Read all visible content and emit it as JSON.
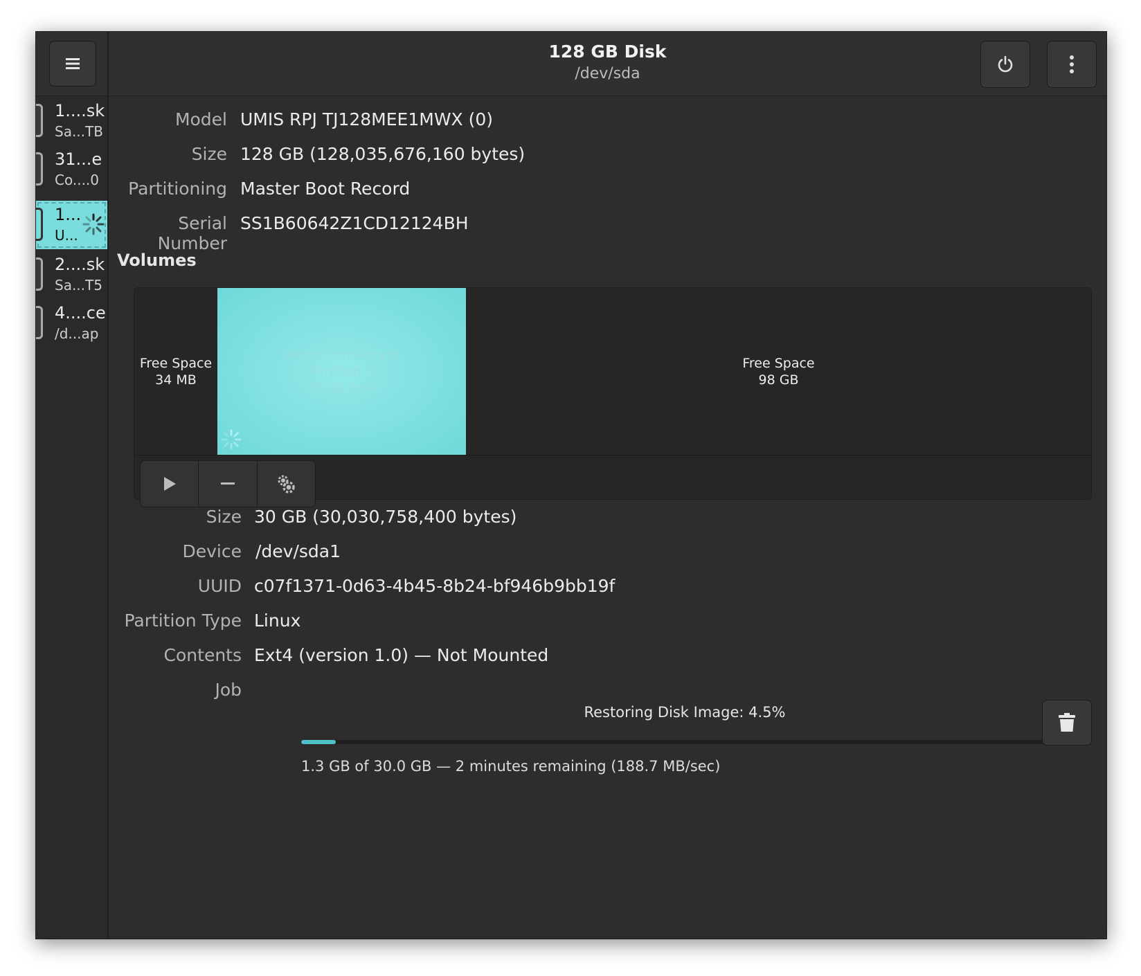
{
  "window": {
    "title": "128 GB Disk",
    "subtitle": "/dev/sda"
  },
  "header": {
    "menu_icon": "hamburger-menu-icon",
    "power_icon": "power-icon",
    "more_icon": "vertical-dots-icon"
  },
  "sidebar": {
    "drives": [
      {
        "line1": "1....sk",
        "line2": "Sa...TB",
        "selected": false
      },
      {
        "line1": "31...e",
        "line2": "Co....0",
        "selected": false
      },
      {
        "line1": "1...",
        "line2": "U...",
        "selected": true
      },
      {
        "line1": "2....sk",
        "line2": "Sa...T5",
        "selected": false
      },
      {
        "line1": "4....ce",
        "line2": "/d...ap",
        "selected": false
      }
    ]
  },
  "disk_info": [
    {
      "label": "Model",
      "value": "UMIS RPJ TJ128MEE1MWX (0)"
    },
    {
      "label": "Size",
      "value": "128 GB (128,035,676,160 bytes)"
    },
    {
      "label": "Partitioning",
      "value": "Master Boot Record"
    },
    {
      "label": "Serial Number",
      "value": "SS1B60642Z1CD12124BH"
    }
  ],
  "volumes": {
    "heading": "Volumes",
    "segments": [
      {
        "line1": "Free Space",
        "line2": "34 MB"
      },
      {
        "line1": "jetson-nvme-prem",
        "line2": "Partition 1",
        "line3": "30 GB Ext4"
      },
      {
        "line1": "Free Space",
        "line2": "98 GB"
      }
    ],
    "toolbar": {
      "play_icon": "play-icon",
      "minus_icon": "minus-icon",
      "gear_icon": "gears-icon"
    }
  },
  "partition_info": [
    {
      "label": "Size",
      "value": "30 GB (30,030,758,400 bytes)"
    },
    {
      "label": "Device",
      "value": "/dev/sda1"
    },
    {
      "label": "UUID",
      "value": "c07f1371-0d63-4b45-8b24-bf946b9bb19f"
    },
    {
      "label": "Partition Type",
      "value": "Linux"
    },
    {
      "label": "Contents",
      "value": "Ext4 (version 1.0) — Not Mounted"
    }
  ],
  "job": {
    "label": "Job",
    "title": "Restoring Disk Image: 4.5%",
    "progress_percent": 4.5,
    "detail": "1.3 GB of 30.0 GB — 2 minutes remaining (188.7 MB/sec)",
    "cancel_icon": "trash-icon"
  },
  "colors": {
    "accent": "#7adcdc",
    "progress": "#4fc3c7",
    "background": "#2d2d2d"
  }
}
